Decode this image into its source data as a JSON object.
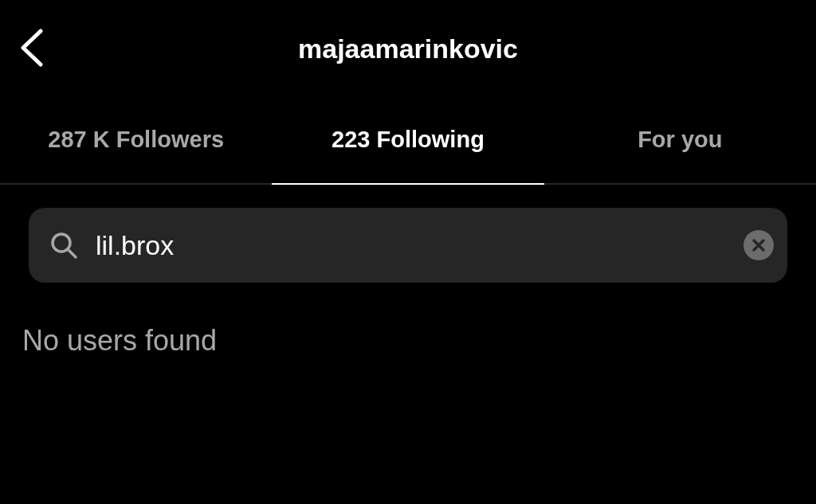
{
  "header": {
    "title": "majaamarinkovic"
  },
  "tabs": [
    {
      "label": "287 K Followers",
      "selected": false
    },
    {
      "label": "223 Following",
      "selected": true
    },
    {
      "label": "For you",
      "selected": false
    }
  ],
  "search": {
    "value": "lil.brox"
  },
  "message": "No users found"
}
